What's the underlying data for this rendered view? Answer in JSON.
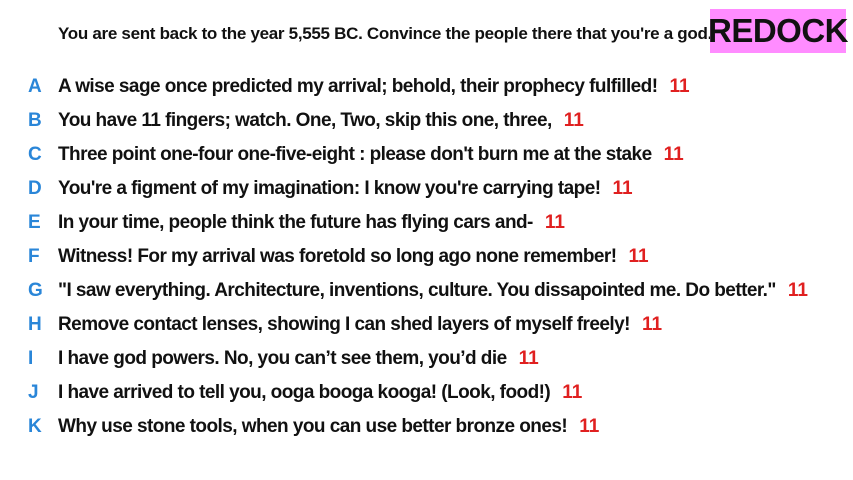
{
  "prompt": "You are sent back to the year 5,555 BC. Convince the people there that you're a god.",
  "logo": "REDOCK",
  "colors": {
    "letter": "#2a86d8",
    "score": "#e02020",
    "logo_bg": "#ff8cff"
  },
  "answers": [
    {
      "letter": "A",
      "text": "A wise sage once predicted my arrival; behold, their prophecy fulfilled!",
      "score": "11"
    },
    {
      "letter": "B",
      "text": "You have 11 fingers; watch. One, Two, skip this one, three,",
      "score": "11"
    },
    {
      "letter": "C",
      "text": "Three point one-four one-five-eight : please don't burn me at the stake",
      "score": "11"
    },
    {
      "letter": "D",
      "text": "You're a figment of my imagination: I know you're carrying tape!",
      "score": "11"
    },
    {
      "letter": "E",
      "text": "In your time, people think the future has flying cars and-",
      "score": "11"
    },
    {
      "letter": "F",
      "text": "Witness! For my arrival was foretold so long ago none remember!",
      "score": "11"
    },
    {
      "letter": "G",
      "text": "\"I saw everything. Architecture, inventions, culture. You dissapointed me. Do better.\"",
      "score": "11"
    },
    {
      "letter": "H",
      "text": "Remove contact lenses, showing I can shed layers of myself freely!",
      "score": "11"
    },
    {
      "letter": "I",
      "text": "I have god powers. No, you can’t see them, you’d die",
      "score": "11"
    },
    {
      "letter": "J",
      "text": "I have arrived to tell you, ooga booga kooga! (Look, food!)",
      "score": "11"
    },
    {
      "letter": "K",
      "text": "Why use stone tools, when you can use better bronze ones!",
      "score": "11"
    }
  ]
}
